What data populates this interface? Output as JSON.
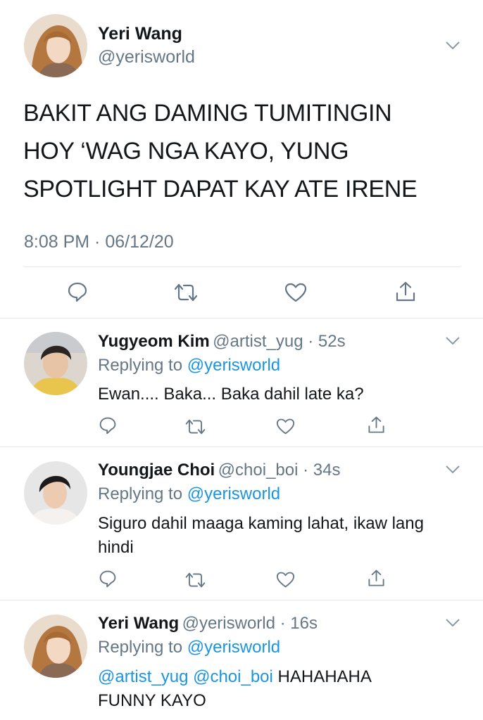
{
  "main_tweet": {
    "name": "Yeri Wang",
    "handle": "@yerisworld",
    "text_lines": [
      "BAKIT ANG DAMING TUMITINGIN",
      "HOY ‘WAG NGA KAYO, YUNG",
      "SPOTLIGHT DAPAT KAY ATE IRENE"
    ],
    "timestamp": "8:08 PM · 06/12/20"
  },
  "replies": [
    {
      "name": "Yugyeom Kim",
      "meta": "@artist_yug · 52s",
      "replying_prefix": "Replying to ",
      "replying_handle": "@yerisworld",
      "text_lines": [
        "Ewan.... Baka... Baka dahil late ka?"
      ]
    },
    {
      "name": "Youngjae Choi",
      "meta": "@choi_boi · 34s",
      "replying_prefix": "Replying to ",
      "replying_handle": "@yerisworld",
      "text_lines": [
        "Siguro dahil maaga kaming lahat, ikaw lang",
        "hindi"
      ]
    },
    {
      "name": "Yeri Wang",
      "meta": "@yerisworld · 16s",
      "replying_prefix": "Replying to ",
      "replying_handle": "@yerisworld",
      "mention1": "@artist_yug",
      "mention2": "@choi_boi",
      "text_rest": " HAHAHAHA",
      "text_line2": "FUNNY KAYO"
    }
  ],
  "colors": {
    "link": "#1b95e0",
    "secondary": "#657786",
    "divider": "#e1e8ed"
  },
  "icons": [
    "reply-icon",
    "retweet-icon",
    "like-icon",
    "share-icon",
    "chevron-down-icon"
  ]
}
